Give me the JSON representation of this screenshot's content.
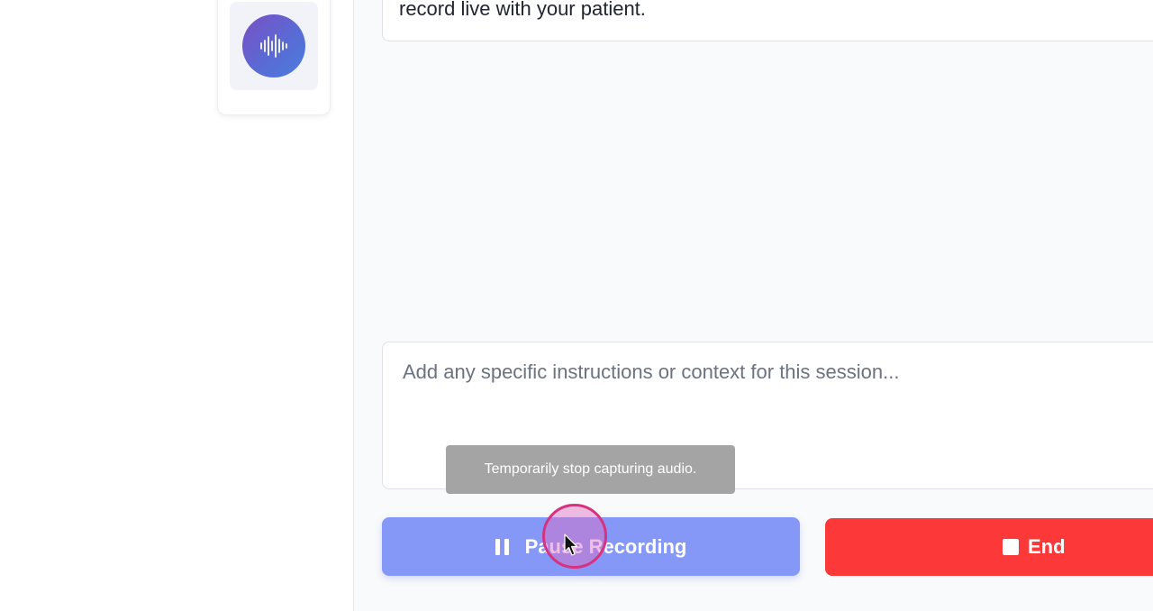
{
  "prompt": {
    "text": "record live with your patient."
  },
  "notes": {
    "placeholder": "Add any specific instructions or context for this session...",
    "value": ""
  },
  "tooltip": {
    "text": "Temporarily stop capturing audio."
  },
  "controls": {
    "pause_label": "Pause Recording",
    "end_label": "End",
    "pause_color": "#8598f8",
    "end_color": "#fc3838"
  },
  "icons": {
    "avatar": "waveform-icon",
    "pause": "pause-icon",
    "stop": "stop-icon",
    "cursor": "mouse-cursor-icon"
  }
}
